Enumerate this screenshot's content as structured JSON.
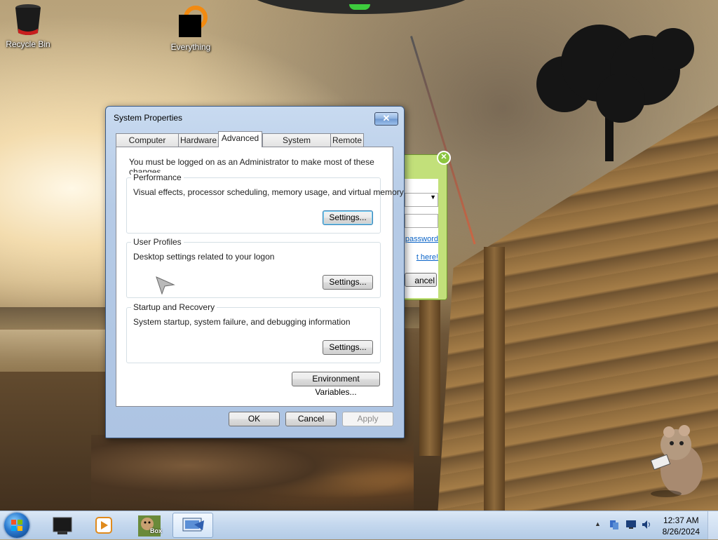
{
  "desktop": {
    "icons": [
      {
        "label": "Recycle Bin",
        "icon": "recycle-bin-icon"
      },
      {
        "label": "Everything",
        "icon": "everything-search-icon"
      }
    ]
  },
  "background_window": {
    "link_password": "password",
    "link_here": "t here!",
    "cancel_label": "ancel"
  },
  "dialog": {
    "title": "System Properties",
    "close_glyph": "✕",
    "tabs": [
      {
        "label": "Computer Name",
        "active": false
      },
      {
        "label": "Hardware",
        "active": false
      },
      {
        "label": "Advanced",
        "active": true
      },
      {
        "label": "System Protection",
        "active": false
      },
      {
        "label": "Remote",
        "active": false
      }
    ],
    "admin_note": "You must be logged on as an Administrator to make most of these changes.",
    "groups": [
      {
        "label": "Performance",
        "description": "Visual effects, processor scheduling, memory usage, and virtual memory",
        "button": "Settings..."
      },
      {
        "label": "User Profiles",
        "description": "Desktop settings related to your logon",
        "button": "Settings..."
      },
      {
        "label": "Startup and Recovery",
        "description": "System startup, system failure, and debugging information",
        "button": "Settings..."
      }
    ],
    "env_button": "Environment Variables...",
    "ok": "OK",
    "cancel": "Cancel",
    "apply": "Apply",
    "apply_enabled": false
  },
  "taskbar": {
    "start_icon": "windows-start-icon",
    "items": [
      {
        "icon": "monitor-app-icon",
        "active": false
      },
      {
        "icon": "media-player-icon",
        "active": false
      },
      {
        "icon": "hamster-box-icon",
        "label": "Box",
        "active": false
      },
      {
        "icon": "system-properties-icon",
        "active": true
      }
    ],
    "tray": {
      "chevron": "▲",
      "time": "12:37 AM",
      "date": "8/26/2024"
    }
  },
  "colors": {
    "dialog_frame": "#b6cbe6",
    "taskbar": "#c5d8ee",
    "link": "#0a64c8",
    "bg_window": "#c2e07a"
  }
}
